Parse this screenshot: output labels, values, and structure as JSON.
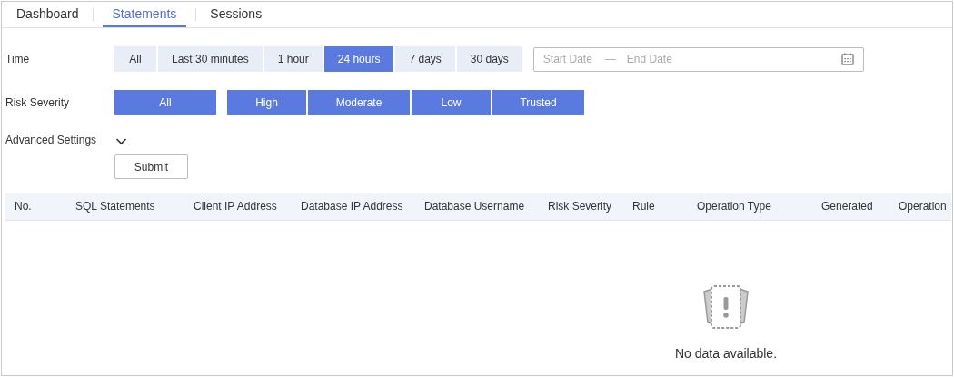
{
  "tabs": [
    {
      "label": "Dashboard",
      "selected": false
    },
    {
      "label": "Statements",
      "selected": true
    },
    {
      "label": "Sessions",
      "selected": false
    }
  ],
  "filters": {
    "time": {
      "label": "Time",
      "options": [
        {
          "label": "All",
          "selected": false
        },
        {
          "label": "Last 30 minutes",
          "selected": false
        },
        {
          "label": "1 hour",
          "selected": false
        },
        {
          "label": "24 hours",
          "selected": true
        },
        {
          "label": "7 days",
          "selected": false
        },
        {
          "label": "30 days",
          "selected": false
        }
      ],
      "date_range": {
        "start_placeholder": "Start Date",
        "separator": "—",
        "end_placeholder": "End Date"
      }
    },
    "risk_severity": {
      "label": "Risk Severity",
      "all": {
        "label": "All",
        "selected": true
      },
      "options": [
        {
          "label": "High",
          "selected": true
        },
        {
          "label": "Moderate",
          "selected": true
        },
        {
          "label": "Low",
          "selected": true
        },
        {
          "label": "Trusted",
          "selected": true
        }
      ]
    },
    "advanced_settings": {
      "label": "Advanced Settings",
      "expanded": false
    },
    "submit": "Submit"
  },
  "table": {
    "columns": [
      "No.",
      "SQL Statements",
      "Client IP Address",
      "Database IP Address",
      "Database Username",
      "Risk Severity",
      "Rule",
      "Operation Type",
      "Generated",
      "Operation"
    ],
    "empty_text": "No data available."
  }
}
